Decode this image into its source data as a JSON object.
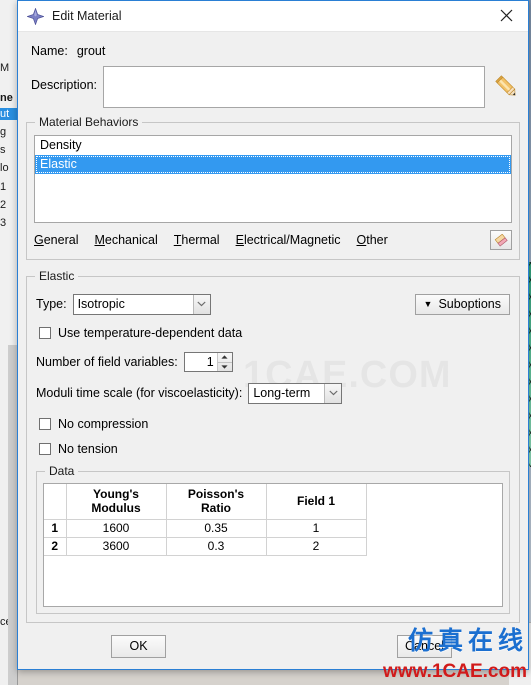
{
  "window": {
    "title": "Edit Material",
    "icon": "abaqus-diamond-icon",
    "close_label": "×",
    "border_color": "#2a7fd4"
  },
  "fields": {
    "name_label": "Name:",
    "name_value": "grout",
    "description_label": "Description:",
    "description_value": "",
    "description_placeholder": "",
    "description_edit_icon": "pencil-icon"
  },
  "material_behaviors": {
    "title": "Material Behaviors",
    "items": [
      {
        "label": "Density",
        "selected": false
      },
      {
        "label": "Elastic",
        "selected": true
      }
    ],
    "selected_color": "#3399f0",
    "menu": [
      {
        "label": "General",
        "mnemonic": "G",
        "rest": "eneral"
      },
      {
        "label": "Mechanical",
        "mnemonic": "M",
        "rest": "echanical"
      },
      {
        "label": "Thermal",
        "mnemonic": "T",
        "rest": "hermal"
      },
      {
        "label": "Electrical/Magnetic",
        "mnemonic": "E",
        "rest": "lectrical/Magnetic"
      },
      {
        "label": "Other",
        "mnemonic": "O",
        "rest": "ther"
      }
    ],
    "eraser_icon": "eraser-icon"
  },
  "elastic": {
    "title": "Elastic",
    "type_label": "Type:",
    "type_value": "Isotropic",
    "type_options": [
      "Isotropic"
    ],
    "suboptions_label": "Suboptions",
    "suboptions_arrow": "▼",
    "use_temp_dependent_label": "Use temperature-dependent data",
    "use_temp_dependent_checked": false,
    "field_variables_label": "Number of field variables:",
    "field_variables_value": "1",
    "moduli_label": "Moduli time scale (for viscoelasticity):",
    "moduli_value": "Long-term",
    "moduli_options": [
      "Long-term"
    ],
    "no_compression_label": "No compression",
    "no_compression_checked": false,
    "no_tension_label": "No tension",
    "no_tension_checked": false
  },
  "data_section": {
    "title": "Data",
    "columns": [
      "",
      "Young's\nModulus",
      "Poisson's\nRatio",
      "Field 1"
    ],
    "column_headers": [
      {
        "line1": "",
        "line2": ""
      },
      {
        "line1": "Young's",
        "line2": "Modulus"
      },
      {
        "line1": "Poisson's",
        "line2": "Ratio"
      },
      {
        "line1": "Field 1",
        "line2": ""
      }
    ],
    "rows": [
      {
        "index": "1",
        "youngs_modulus": "1600",
        "poissons_ratio": "0.35",
        "field_1": "1"
      },
      {
        "index": "2",
        "youngs_modulus": "3600",
        "poissons_ratio": "0.3",
        "field_1": "2"
      }
    ]
  },
  "footer": {
    "ok_label": "OK",
    "cancel_label": "Cancel"
  },
  "watermarks": {
    "center": "1CAE.COM",
    "chinese": "仿真在线",
    "url": "www.1CAE.com",
    "chinese_color": "#1b6fd0",
    "url_color": "#d11a1a"
  },
  "background": {
    "tree_fragments": [
      "M",
      "ne",
      "ut",
      "g",
      "s",
      "lo",
      "1",
      "2",
      "3",
      "ce"
    ]
  }
}
